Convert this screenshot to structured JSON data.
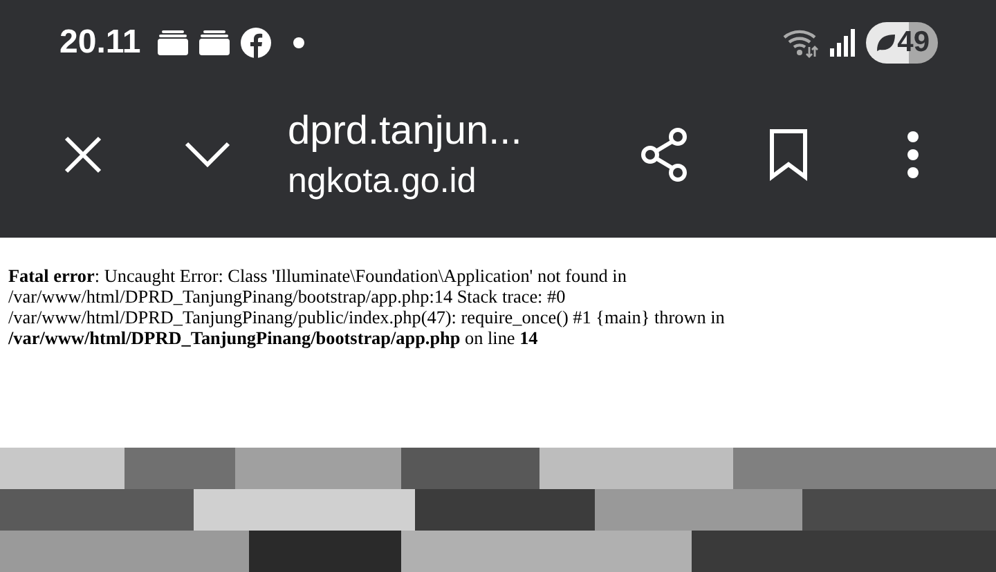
{
  "status_bar": {
    "time": "20.11",
    "battery": "49"
  },
  "toolbar": {
    "title": "dprd.tanjun...",
    "url": "ngkota.go.id"
  },
  "error_message": "**Fatal error**: Uncaught Error: Class 'Illuminate\\Foundation\\Application' not found in /var/www/html/DPRD_TanjungPinang/bootstrap/app.php:14 Stack trace: #0 /var/www/html/DPRD_TanjungPinang/public/index.php(47): require_once() #1 {main} thrown in **/var/www/html/DPRD_TanjungPinang/bootstrap/app.php** on line **14**"
}
